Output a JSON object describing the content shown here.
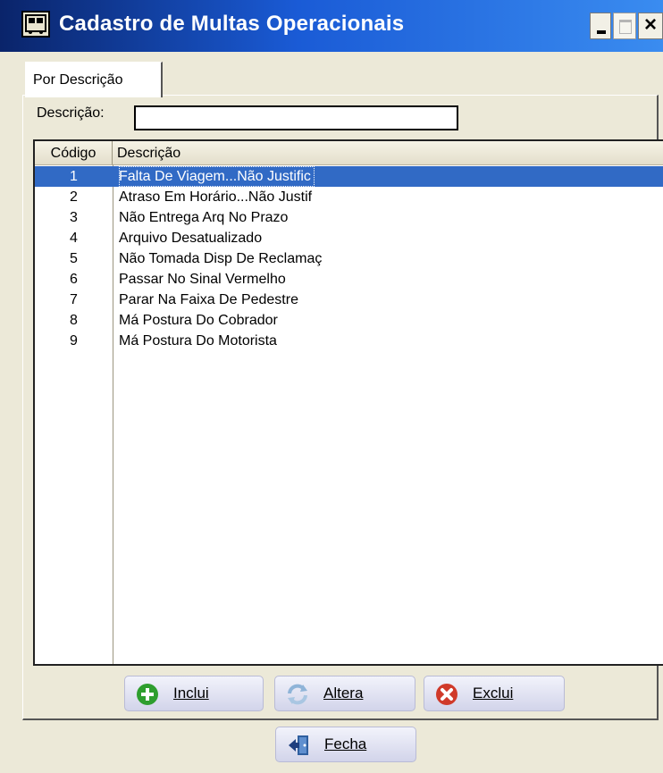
{
  "window": {
    "title": "Cadastro de Multas Operacionais",
    "close_glyph": "×"
  },
  "tab": {
    "label": "Por Descrição"
  },
  "search": {
    "label": "Descrição:",
    "value": ""
  },
  "grid": {
    "columns": [
      "Código",
      "Descrição"
    ],
    "selected_index": 0,
    "rows": [
      {
        "code": "1",
        "desc": "Falta De Viagem...Não Justific"
      },
      {
        "code": "2",
        "desc": "Atraso Em Horário...Não Justif"
      },
      {
        "code": "3",
        "desc": "Não Entrega Arq No Prazo"
      },
      {
        "code": "4",
        "desc": "Arquivo Desatualizado"
      },
      {
        "code": "5",
        "desc": "Não Tomada Disp De Reclamaç"
      },
      {
        "code": "6",
        "desc": "Passar No Sinal Vermelho"
      },
      {
        "code": "7",
        "desc": "Parar Na Faixa De Pedestre"
      },
      {
        "code": "8",
        "desc": "Má Postura Do Cobrador"
      },
      {
        "code": "9",
        "desc": "Má Postura Do Motorista"
      }
    ]
  },
  "buttons": {
    "inclui": "Inclui",
    "altera": "Altera",
    "exclui": "Exclui",
    "fecha": "Fecha"
  },
  "icons": {
    "window": "bus-icon",
    "inclui": "plus-circle-icon",
    "altera": "refresh-icon",
    "exclui": "x-circle-icon",
    "fecha": "exit-door-icon"
  },
  "colors": {
    "title_bar": "#0a246a",
    "selection": "#316ac5",
    "add": "#2e9e2e",
    "delete": "#d03a2a"
  }
}
